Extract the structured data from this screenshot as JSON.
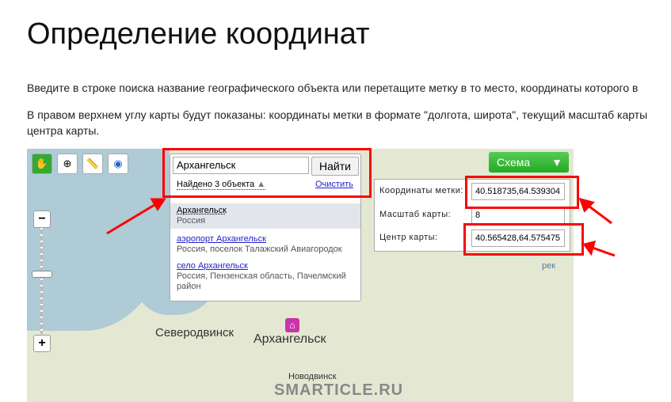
{
  "title": "Определение координат",
  "para1": "Введите в строке поиска название географического объекта или перетащите метку в то место, координаты которого в",
  "para2a": "В правом верхнем углу карты будут показаны: координаты метки в формате \"долгота, широта\", текущий масштаб карты",
  "para2b": "центра карты.",
  "search": {
    "value": "Архангельск",
    "button": "Найти",
    "found": "Найдено 3 объекта",
    "clear": "Очистить"
  },
  "results": [
    {
      "title": "Архангельск",
      "subtitle": "Россия"
    },
    {
      "title": "аэропорт Архангельск",
      "subtitle": "Россия, поселок Талажский Авиагородок"
    },
    {
      "title": "село Архангельск",
      "subtitle": "Россия, Пензенская область, Пачелмский район"
    }
  ],
  "map_type": "Схема",
  "info": {
    "coords_label": "Координаты метки:",
    "coords_value": "40.518735,64.539304",
    "scale_label": "Масштаб карты:",
    "scale_value": "8",
    "center_label": "Центр карты:",
    "center_value": "40.565428,64.575475"
  },
  "cities": {
    "severodvinsk": "Северодвинск",
    "arkhangelsk": "Архангельск",
    "novodvinsk": "Новодвинск",
    "river": "рек"
  },
  "watermark": "SMARTICLE.RU",
  "zoom": {
    "plus": "+",
    "minus": "−"
  }
}
